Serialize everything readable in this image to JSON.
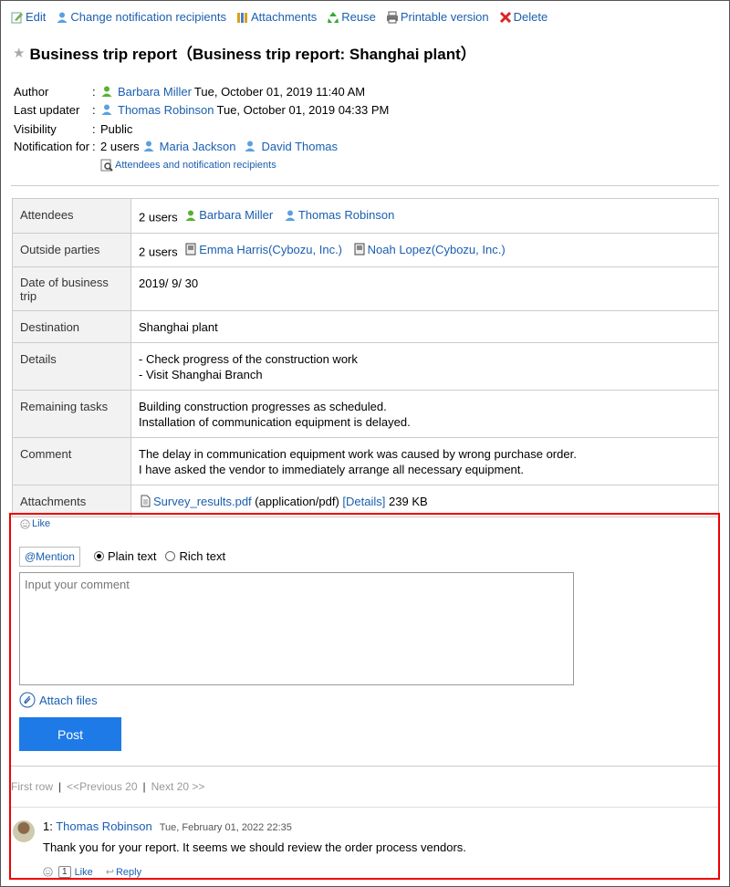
{
  "toolbar": {
    "edit": "Edit",
    "change_recipients": "Change notification recipients",
    "attachments": "Attachments",
    "reuse": "Reuse",
    "printable": "Printable version",
    "delete": "Delete"
  },
  "title": "Business trip report（Business trip report: Shanghai plant）",
  "meta": {
    "author_label": "Author",
    "author_name": "Barbara Miller",
    "author_date": "Tue, October 01, 2019 11:40 AM",
    "updater_label": "Last updater",
    "updater_name": "Thomas Robinson",
    "updater_date": "Tue, October 01, 2019 04:33 PM",
    "visibility_label": "Visibility",
    "visibility_value": "Public",
    "notification_label": "Notification for",
    "notification_count": "2 users",
    "notification_user1": "Maria Jackson",
    "notification_user2": "David Thomas",
    "attendees_link": "Attendees and notification recipients",
    "colon": ":"
  },
  "fields": {
    "attendees_label": "Attendees",
    "attendees_count": "2 users",
    "attendee1": "Barbara Miller",
    "attendee2": "Thomas Robinson",
    "outside_label": "Outside parties",
    "outside_count": "2 users",
    "outside1": "Emma Harris(Cybozu, Inc.)",
    "outside2": "Noah Lopez(Cybozu, Inc.)",
    "date_label": "Date of business trip",
    "date_value": "2019/ 9/ 30",
    "destination_label": "Destination",
    "destination_value": "Shanghai plant",
    "details_label": "Details",
    "details_line1": "- Check progress of the construction work",
    "details_line2": "- Visit Shanghai Branch",
    "remaining_label": "Remaining tasks",
    "remaining_line1": "Building construction progresses as scheduled.",
    "remaining_line2": "Installation of communication equipment is delayed.",
    "comment_label": "Comment",
    "comment_line1": "The delay in communication equipment work was caused by wrong purchase order.",
    "comment_line2": "I have asked the vendor to immediately arrange all necessary equipment.",
    "attachments_label": "Attachments",
    "file_name": "Survey_results.pdf",
    "file_type": "(application/pdf)",
    "file_details": "[Details]",
    "file_size": "239 KB"
  },
  "comment_form": {
    "like": "Like",
    "mention": "@Mention",
    "plain_text": "Plain text",
    "rich_text": "Rich text",
    "placeholder": "Input your comment",
    "attach_files": "Attach files",
    "post": "Post"
  },
  "pager": {
    "first": "First row",
    "prev": "<<Previous 20",
    "next": "Next 20 >>",
    "sep": "|"
  },
  "comments": [
    {
      "number": "1:",
      "author": "Thomas Robinson",
      "date": "Tue, February 01, 2022 22:35",
      "text": "Thank you for your report. It seems we should review the order process vendors.",
      "like_count": "1",
      "like": "Like",
      "reply": "Reply"
    }
  ],
  "colors": {
    "link": "#1a5eb0",
    "post_button": "#1e7ae6",
    "highlight_border": "#e00000",
    "label_bg": "#f2f2f2"
  }
}
